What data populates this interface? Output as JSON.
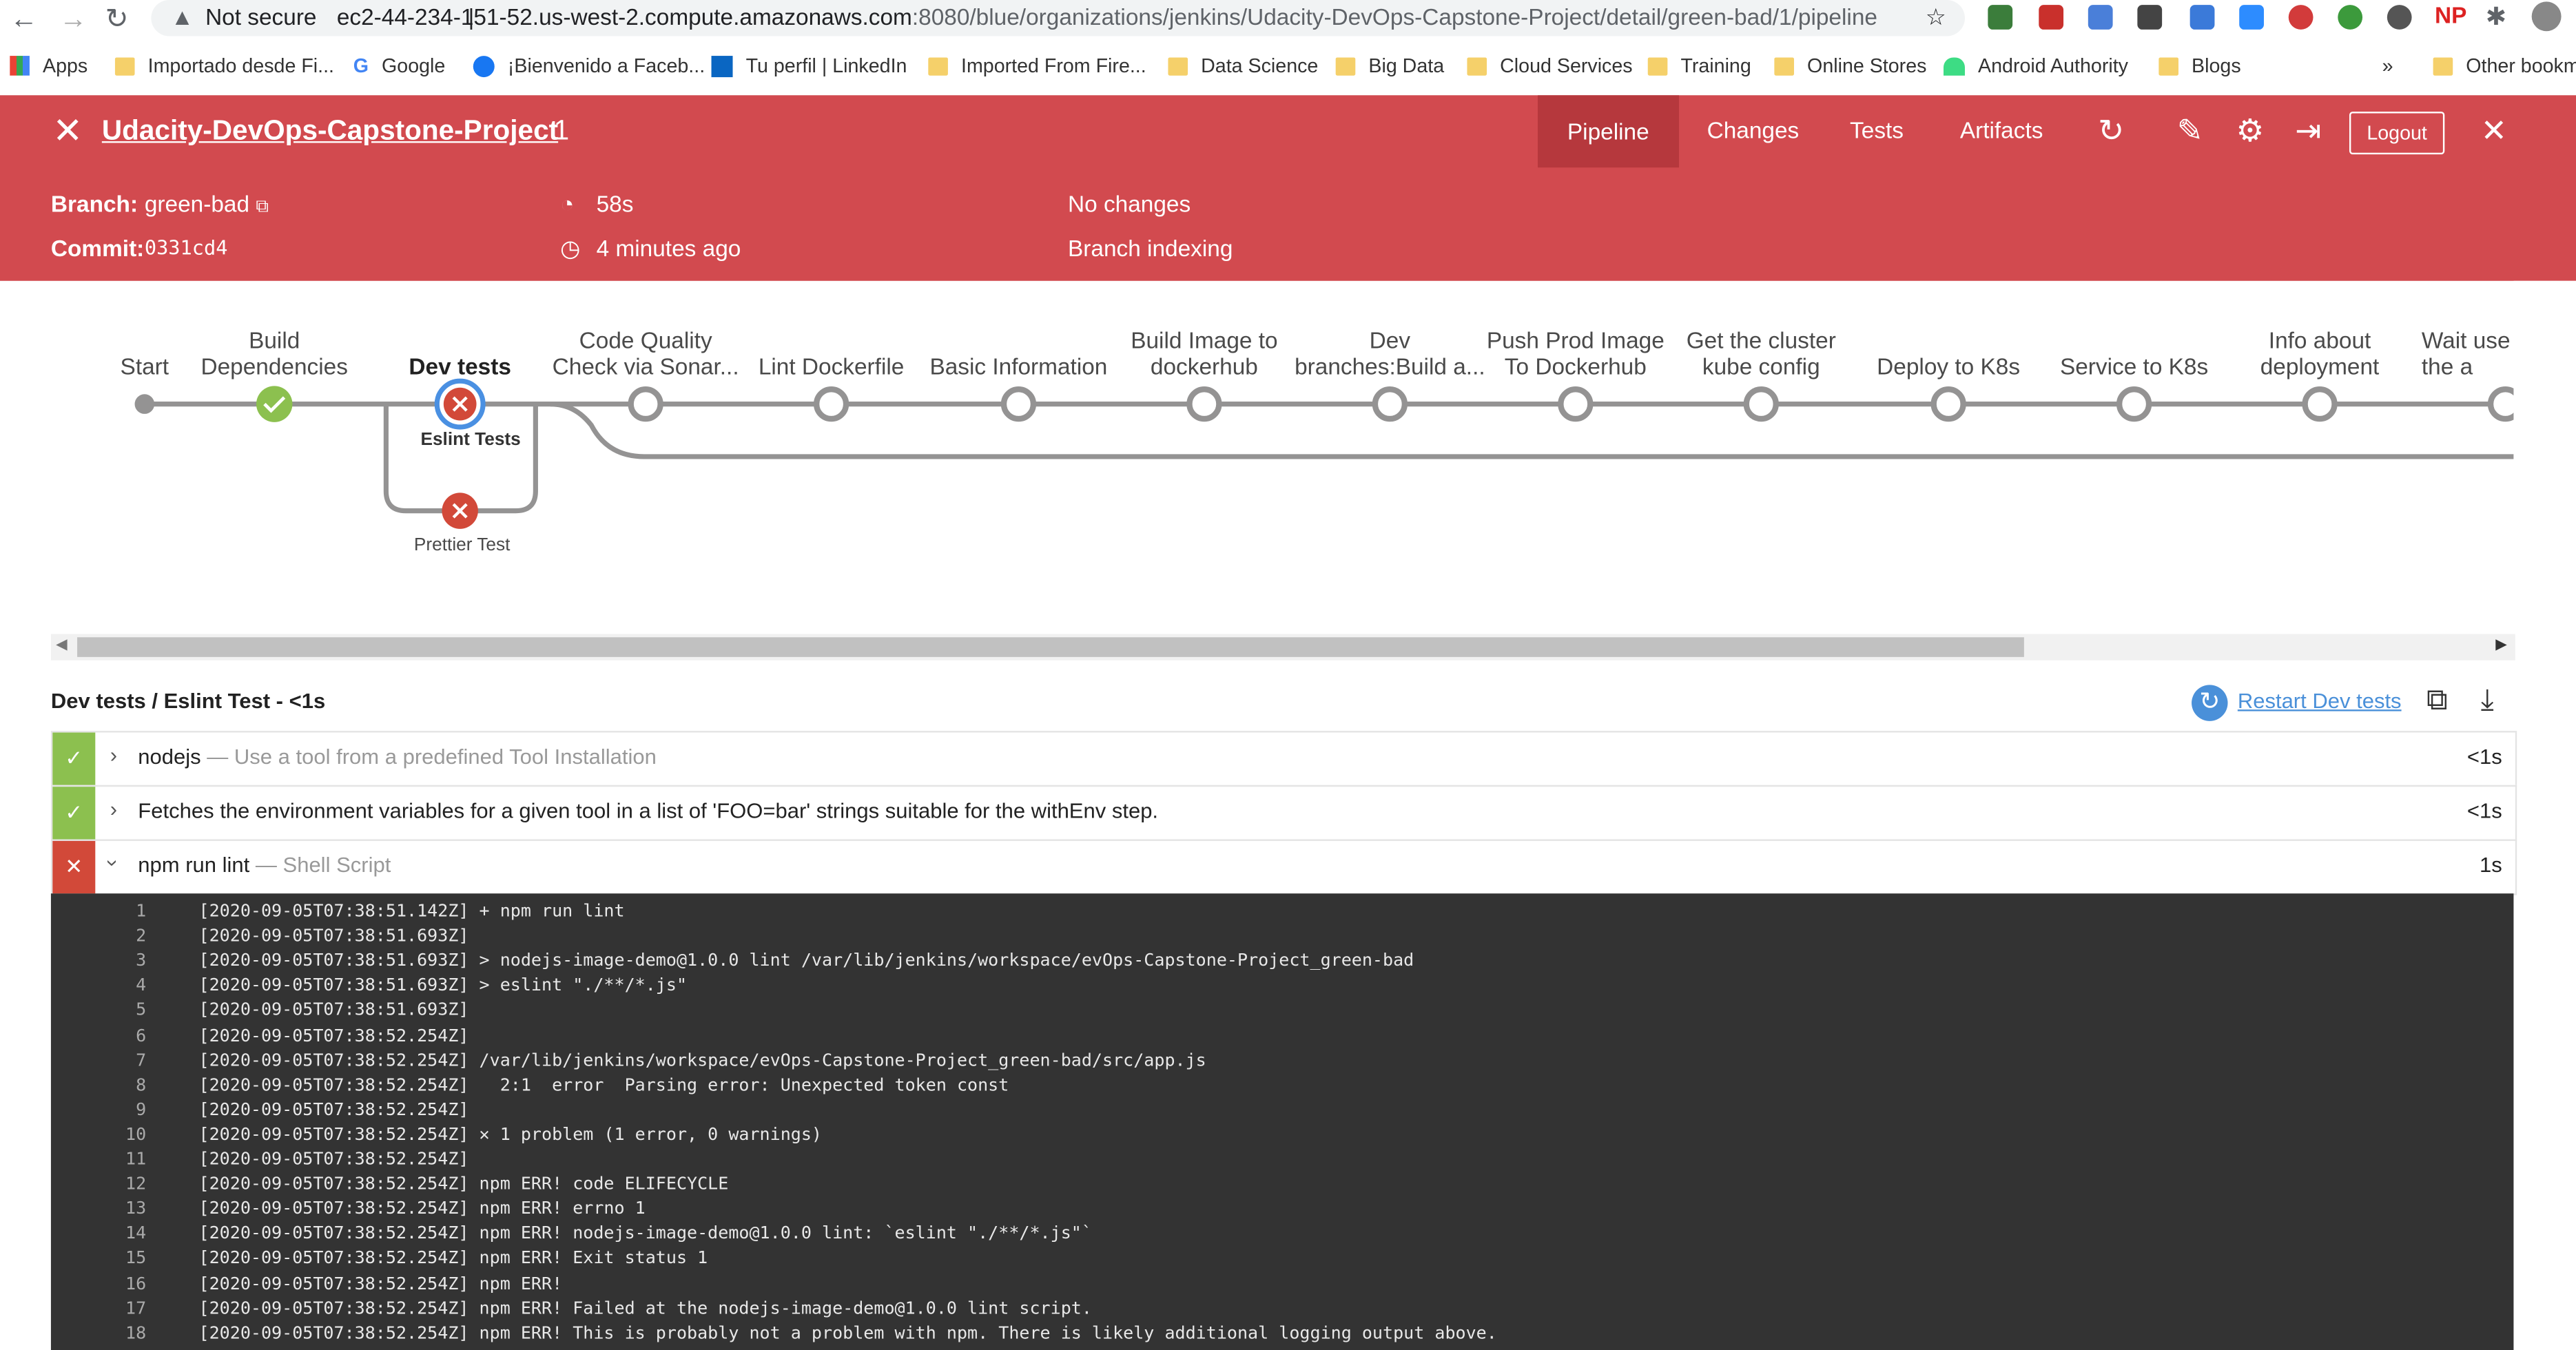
{
  "browser": {
    "security": "Not secure",
    "url_host": "ec2-44-234-151-52.us-west-2.compute.amazonaws.com",
    "url_path": ":8080/blue/organizations/jenkins/Udacity-DevOps-Capstone-Project/detail/green-bad/1/pipeline",
    "bookmarks": [
      "Apps",
      "Importado desde Fi...",
      "Google",
      "¡Bienvenido a Faceb...",
      "Tu perfil | LinkedIn",
      "Imported From Fire...",
      "Data Science",
      "Big Data",
      "Cloud Services",
      "Training",
      "Online Stores",
      "Android Authority",
      "Blogs"
    ],
    "overflow": "»",
    "other_bookmarks": "Other bookm"
  },
  "header": {
    "title": "Udacity-DevOps-Capstone-Project",
    "run_number": "1",
    "tabs": [
      "Pipeline",
      "Changes",
      "Tests",
      "Artifacts"
    ],
    "logout": "Logout",
    "branch_label": "Branch:",
    "branch_value": "green-bad",
    "commit_label": "Commit:",
    "commit_value": "0331cd4",
    "duration": "58s",
    "time_ago": "4 minutes ago",
    "changes": "No changes",
    "cause": "Branch indexing",
    "color": "#d24a4f"
  },
  "pipeline": {
    "stages": [
      {
        "label": "Start",
        "status": "start"
      },
      {
        "label": "Build Dependencies",
        "status": "success"
      },
      {
        "label": "Dev tests",
        "status": "failed"
      },
      {
        "label": "Code Quality Check via Sonar...",
        "status": "not-built"
      },
      {
        "label": "Lint Dockerfile",
        "status": "not-built"
      },
      {
        "label": "Basic Information",
        "status": "not-built"
      },
      {
        "label": "Build Image to dockerhub",
        "status": "not-built"
      },
      {
        "label": "Dev branches:Build a...",
        "status": "not-built"
      },
      {
        "label": "Push Prod Image To Dockerhub",
        "status": "not-built"
      },
      {
        "label": "Get the cluster kube config",
        "status": "not-built"
      },
      {
        "label": "Deploy to K8s",
        "status": "not-built"
      },
      {
        "label": "Service to K8s",
        "status": "not-built"
      },
      {
        "label": "Info about deployment",
        "status": "not-built"
      },
      {
        "label": "Wait use the a",
        "status": "not-built"
      }
    ],
    "parallel": [
      "Eslint Tests",
      "Prettier Test"
    ]
  },
  "log": {
    "breadcrumb": "Dev tests / Eslint Test - <1s",
    "restart": "Restart Dev tests",
    "steps": [
      {
        "name": "nodejs",
        "desc": "— Use a tool from a predefined Tool Installation",
        "time": "<1s",
        "status": "success",
        "expanded": false
      },
      {
        "name": "Fetches the environment variables for a given tool in a list of 'FOO=bar' strings suitable for the withEnv step.",
        "desc": "",
        "time": "<1s",
        "status": "success",
        "expanded": false
      },
      {
        "name": "npm run lint",
        "desc": "— Shell Script",
        "time": "1s",
        "status": "failed",
        "expanded": true
      }
    ],
    "lines": [
      "[2020-09-05T07:38:51.142Z] + npm run lint",
      "[2020-09-05T07:38:51.693Z]",
      "[2020-09-05T07:38:51.693Z] > nodejs-image-demo@1.0.0 lint /var/lib/jenkins/workspace/evOps-Capstone-Project_green-bad",
      "[2020-09-05T07:38:51.693Z] > eslint \"./**/*.js\"",
      "[2020-09-05T07:38:51.693Z]",
      "[2020-09-05T07:38:52.254Z]",
      "[2020-09-05T07:38:52.254Z] /var/lib/jenkins/workspace/evOps-Capstone-Project_green-bad/src/app.js",
      "[2020-09-05T07:38:52.254Z]   2:1  error  Parsing error: Unexpected token const",
      "[2020-09-05T07:38:52.254Z]",
      "[2020-09-05T07:38:52.254Z] ✕ 1 problem (1 error, 0 warnings)",
      "[2020-09-05T07:38:52.254Z]",
      "[2020-09-05T07:38:52.254Z] npm ERR! code ELIFECYCLE",
      "[2020-09-05T07:38:52.254Z] npm ERR! errno 1",
      "[2020-09-05T07:38:52.254Z] npm ERR! nodejs-image-demo@1.0.0 lint: `eslint \"./**/*.js\"`",
      "[2020-09-05T07:38:52.254Z] npm ERR! Exit status 1",
      "[2020-09-05T07:38:52.254Z] npm ERR!",
      "[2020-09-05T07:38:52.254Z] npm ERR! Failed at the nodejs-image-demo@1.0.0 lint script.",
      "[2020-09-05T07:38:52.254Z] npm ERR! This is probably not a problem with npm. There is likely additional logging output above."
    ]
  }
}
